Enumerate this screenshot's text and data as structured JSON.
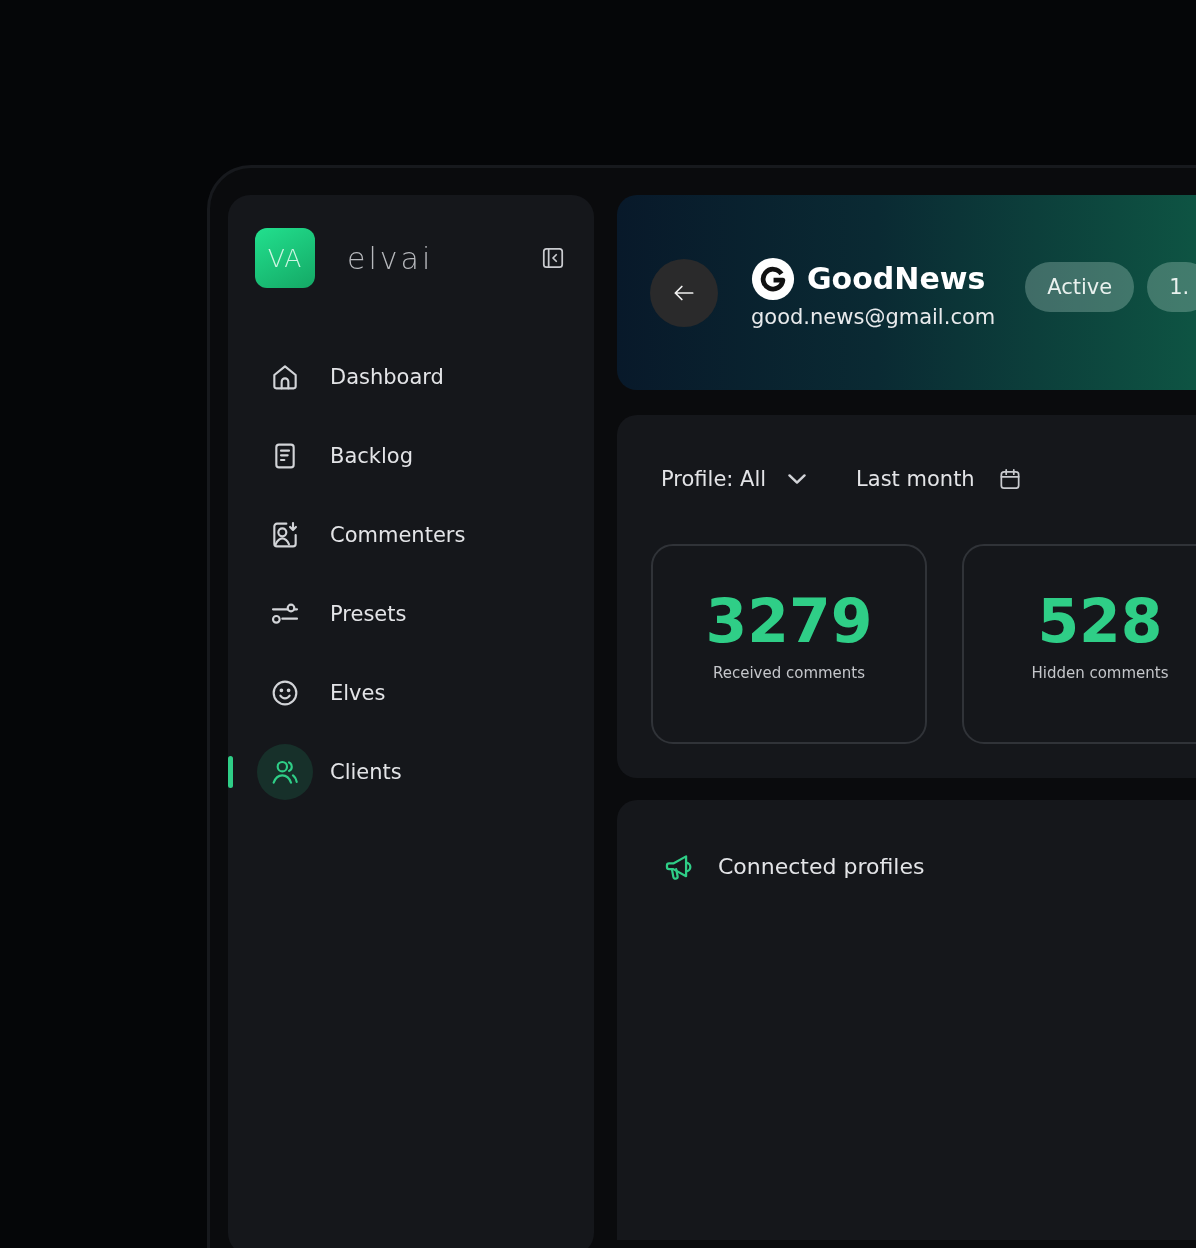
{
  "sidebar": {
    "logo": {
      "mark": "VA",
      "wordmark": "elvai"
    },
    "nav_items": [
      {
        "label": "Dashboard",
        "selected": false
      },
      {
        "label": "Backlog",
        "selected": false
      },
      {
        "label": "Commenters",
        "selected": false
      },
      {
        "label": "Presets",
        "selected": false
      },
      {
        "label": "Elves",
        "selected": false
      },
      {
        "label": "Clients",
        "selected": true
      }
    ]
  },
  "header": {
    "client": {
      "name": "GoodNews",
      "email": "good.news@gmail.com"
    },
    "chips": [
      "Active",
      "1."
    ]
  },
  "filters": {
    "profile": "Profile: All",
    "period": "Last month"
  },
  "stats": [
    {
      "value": "3279",
      "label": "Received comments"
    },
    {
      "value": "528",
      "label": "Hidden comments"
    }
  ],
  "connected_profiles": {
    "title": "Connected profiles"
  }
}
